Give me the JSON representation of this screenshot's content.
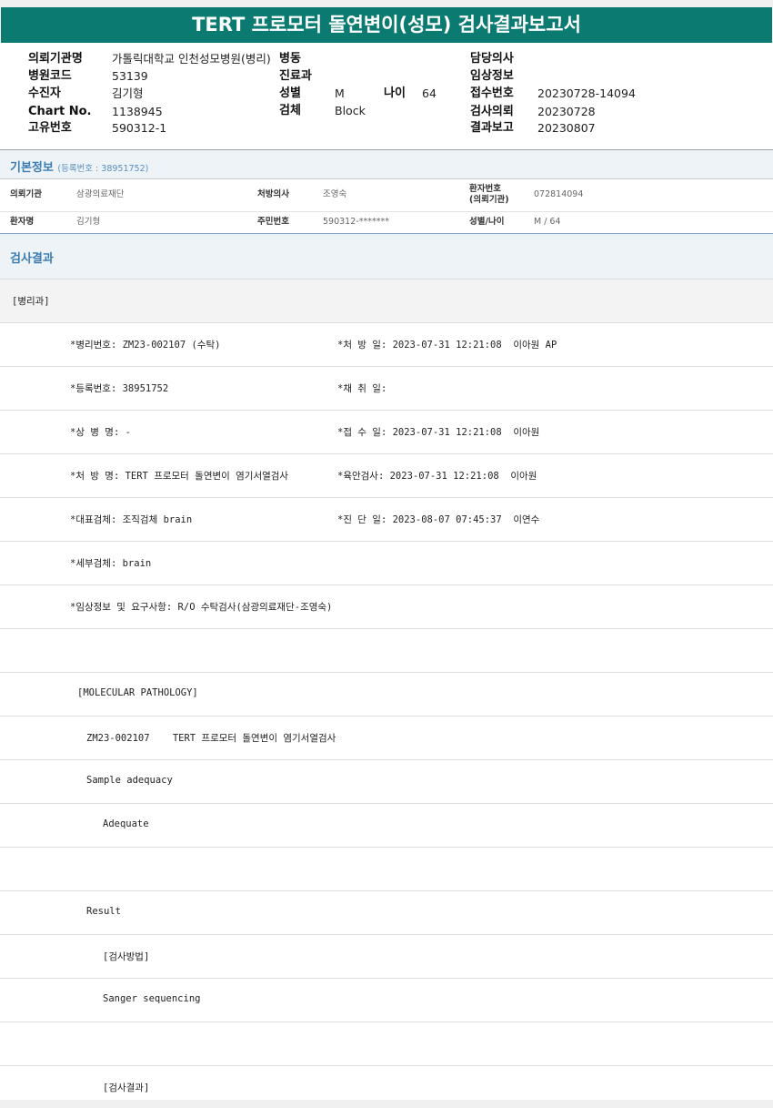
{
  "title": "TERT 프로모터 돌연변이(성모) 검사결과보고서",
  "header": {
    "institution_label": "의뢰기관명",
    "institution_value": "가톨릭대학교 인천성모병원(병리)",
    "ward_label": "병동",
    "doctor_label": "담당의사",
    "hospital_code_label": "병원코드",
    "hospital_code_value": "53139",
    "dept_label": "진료과",
    "clinical_info_label": "임상정보",
    "patient_label": "수진자",
    "patient_value": "김기형",
    "sex_label": "성별",
    "sex_value": "M",
    "age_label": "나이",
    "age_value": "64",
    "receipt_no_label": "접수번호",
    "receipt_no_value": "20230728-14094",
    "chart_no_label": "Chart No.",
    "chart_no_value": "1138945",
    "specimen_label": "검체",
    "specimen_value": "Block",
    "request_label": "검사의뢰",
    "request_value": "20230728",
    "unique_no_label": "고유번호",
    "unique_no_value": "590312-1",
    "report_label": "결과보고",
    "report_value": "20230807"
  },
  "basic_info": {
    "title": "기본정보",
    "reg_no": "(등록번호 : 38951752)",
    "institution_label": "의뢰기관",
    "institution_value": "삼광의료재단",
    "prescriber_label": "처방의사",
    "prescriber_value": "조영숙",
    "patient_no_label_1": "환자번호",
    "patient_no_label_2": "(의뢰기관)",
    "patient_no_value": "072814094",
    "patient_name_label": "환자명",
    "patient_name_value": "김기형",
    "rrn_label": "주민번호",
    "rrn_value": "590312-*******",
    "sex_age_label": "성별/나이",
    "sex_age_value": "M / 64"
  },
  "results": {
    "title": "검사결과",
    "dept": "[병리과]",
    "pathology_no": "*병리번호: ZM23-002107 (수탁)",
    "prescribe_date": "*처 방 일: 2023-07-31 12:21:08  이아원 AP",
    "reg_no": "*등록번호: 38951752",
    "collect_date": "*채 취 일:",
    "disease_name": "*상 병 명: -",
    "receive_date": "*접 수 일: 2023-07-31 12:21:08  이아원",
    "order_name": "*처 방 명: TERT 프로모터 돌연변이 염기서열검사",
    "gross_exam": "*육안검사: 2023-07-31 12:21:08  이아원",
    "rep_specimen": "*대표검체: 조직검체 brain",
    "diagnosis_date": "*진 단 일: 2023-08-07 07:45:37  이연수",
    "sub_specimen": "*세부검체: brain",
    "clinical_request": "*임상정보 및 요구사항: R/O 수탁검사(삼광의료재단-조영숙)",
    "molecular": "[MOLECULAR PATHOLOGY]",
    "test_line": "ZM23-002107    TERT 프로모터 돌연변이 염기서열검사",
    "sample_adequacy": "Sample adequacy",
    "adequate": "Adequate",
    "result": "Result",
    "method_header": "[검사방법]",
    "method": "Sanger sequencing",
    "result_header": "[검사결과]"
  },
  "colors": {
    "title_bar": "#0b7b72",
    "section_title": "#3a7bb0",
    "section_bg": "#eef3f7"
  }
}
